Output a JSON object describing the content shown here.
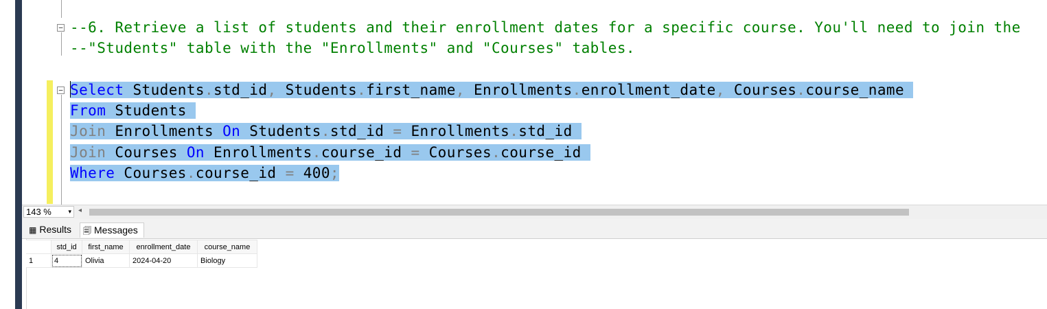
{
  "editor": {
    "comment_line1": "--6. Retrieve a list of students and their enrollment dates for a specific course. You'll need to join the",
    "comment_line2": "--\"Students\" table with the \"Enrollments\" and \"Courses\" tables.",
    "fold_symbol": "−",
    "query": {
      "l1_kw": "Select",
      "l1_a": " Students",
      "l1_b": "std_id",
      "l1_c": " Students",
      "l1_d": "first_name",
      "l1_e": " Enrollments",
      "l1_f": "enrollment_date",
      "l1_g": " Courses",
      "l1_h": "course_name ",
      "l2_kw": "From",
      "l2_a": " Students ",
      "l3_kw": "Join",
      "l3_a": " Enrollments ",
      "l3_on": "On",
      "l3_b": " Students",
      "l3_c": "std_id ",
      "l3_d": " Enrollments",
      "l3_e": "std_id ",
      "l4_kw": "Join",
      "l4_a": " Courses ",
      "l4_on": "On",
      "l4_b": " Enrollments",
      "l4_c": "course_id ",
      "l4_d": " Courses",
      "l4_e": "course_id ",
      "l5_kw": "Where",
      "l5_a": " Courses",
      "l5_b": "course_id ",
      "l5_c": " 400",
      "dot": ".",
      "comma": ",",
      "eq": "=",
      "semi": ";"
    }
  },
  "statusbar": {
    "zoom": "143 %",
    "zoom_dropdown_icon": "▾",
    "scroll_left_icon": "◂"
  },
  "results": {
    "tabs": [
      {
        "label": "Results",
        "icon": "grid-icon",
        "glyph": "▦"
      },
      {
        "label": "Messages",
        "icon": "messages-icon",
        "glyph": "🗐"
      }
    ],
    "columns": [
      "std_id",
      "first_name",
      "enrollment_date",
      "course_name"
    ],
    "rows": [
      {
        "num": "1",
        "cells": [
          "4",
          "Olivia",
          "2024-04-20",
          "Biology"
        ]
      }
    ]
  }
}
